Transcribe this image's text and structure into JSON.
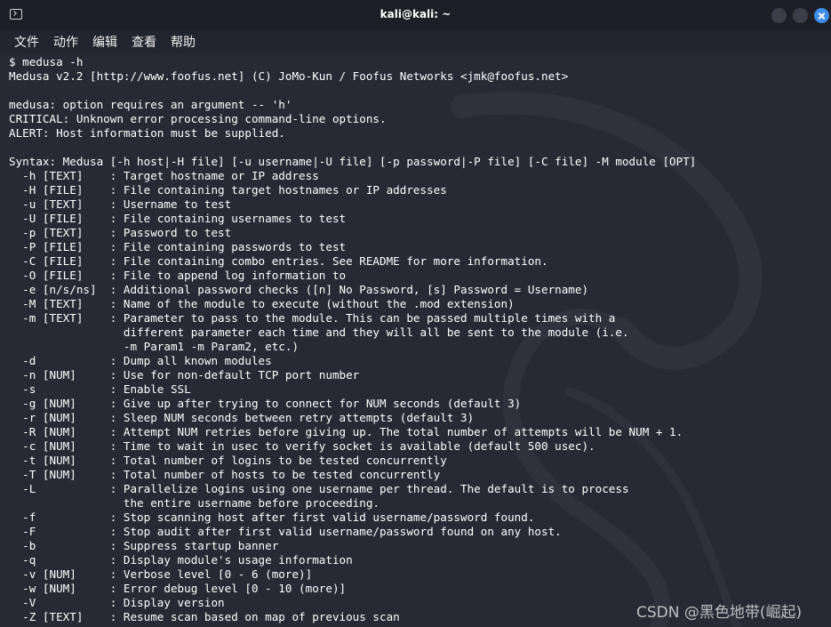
{
  "window": {
    "title": "kali@kali: ~"
  },
  "menubar": {
    "items": [
      "文件",
      "动作",
      "编辑",
      "查看",
      "帮助"
    ]
  },
  "terminal": {
    "lines": [
      "$ medusa -h",
      "Medusa v2.2 [http://www.foofus.net] (C) JoMo-Kun / Foofus Networks <jmk@foofus.net>",
      "",
      "medusa: option requires an argument -- 'h'",
      "CRITICAL: Unknown error processing command-line options.",
      "ALERT: Host information must be supplied.",
      "",
      "Syntax: Medusa [-h host|-H file] [-u username|-U file] [-p password|-P file] [-C file] -M module [OPT]",
      "  -h [TEXT]    : Target hostname or IP address",
      "  -H [FILE]    : File containing target hostnames or IP addresses",
      "  -u [TEXT]    : Username to test",
      "  -U [FILE]    : File containing usernames to test",
      "  -p [TEXT]    : Password to test",
      "  -P [FILE]    : File containing passwords to test",
      "  -C [FILE]    : File containing combo entries. See README for more information.",
      "  -O [FILE]    : File to append log information to",
      "  -e [n/s/ns]  : Additional password checks ([n] No Password, [s] Password = Username)",
      "  -M [TEXT]    : Name of the module to execute (without the .mod extension)",
      "  -m [TEXT]    : Parameter to pass to the module. This can be passed multiple times with a",
      "                 different parameter each time and they will all be sent to the module (i.e.",
      "                 -m Param1 -m Param2, etc.)",
      "  -d           : Dump all known modules",
      "  -n [NUM]     : Use for non-default TCP port number",
      "  -s           : Enable SSL",
      "  -g [NUM]     : Give up after trying to connect for NUM seconds (default 3)",
      "  -r [NUM]     : Sleep NUM seconds between retry attempts (default 3)",
      "  -R [NUM]     : Attempt NUM retries before giving up. The total number of attempts will be NUM + 1.",
      "  -c [NUM]     : Time to wait in usec to verify socket is available (default 500 usec).",
      "  -t [NUM]     : Total number of logins to be tested concurrently",
      "  -T [NUM]     : Total number of hosts to be tested concurrently",
      "  -L           : Parallelize logins using one username per thread. The default is to process",
      "                 the entire username before proceeding.",
      "  -f           : Stop scanning host after first valid username/password found.",
      "  -F           : Stop audit after first valid username/password found on any host.",
      "  -b           : Suppress startup banner",
      "  -q           : Display module's usage information",
      "  -v [NUM]     : Verbose level [0 - 6 (more)]",
      "  -w [NUM]     : Error debug level [0 - 10 (more)]",
      "  -V           : Display version",
      "  -Z [TEXT]    : Resume scan based on map of previous scan"
    ]
  },
  "watermark": "CSDN @黑色地带(崛起)"
}
